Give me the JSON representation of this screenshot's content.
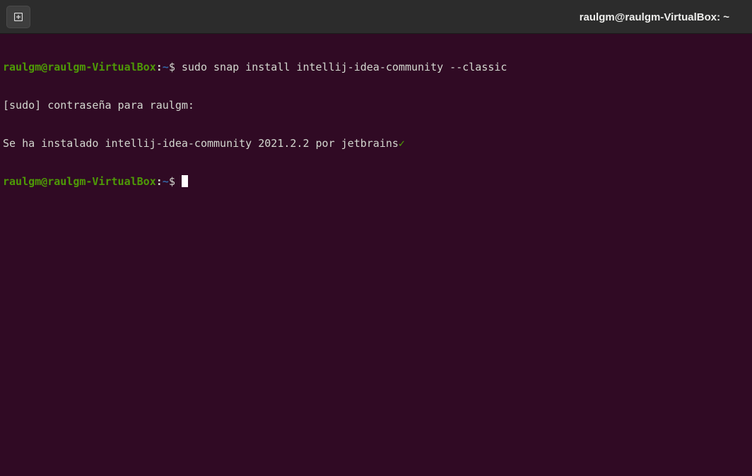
{
  "window": {
    "title": "raulgm@raulgm-VirtualBox: ~"
  },
  "icons": {
    "new_tab": "new-tab-icon"
  },
  "colors": {
    "background": "#300a24",
    "prompt_user": "#4e9a06",
    "prompt_path": "#3465a4",
    "text": "#d3d7cf"
  },
  "terminal": {
    "prompt_user": "raulgm@raulgm-VirtualBox",
    "prompt_colon": ":",
    "prompt_path": "~",
    "prompt_symbol": "$ ",
    "command": "sudo snap install intellij-idea-community --classic",
    "output_sudo": "[sudo] contraseña para raulgm:",
    "output_installed": "Se ha instalado intellij-idea-community 2021.2.2 por jetbrains",
    "output_check": "✓"
  }
}
